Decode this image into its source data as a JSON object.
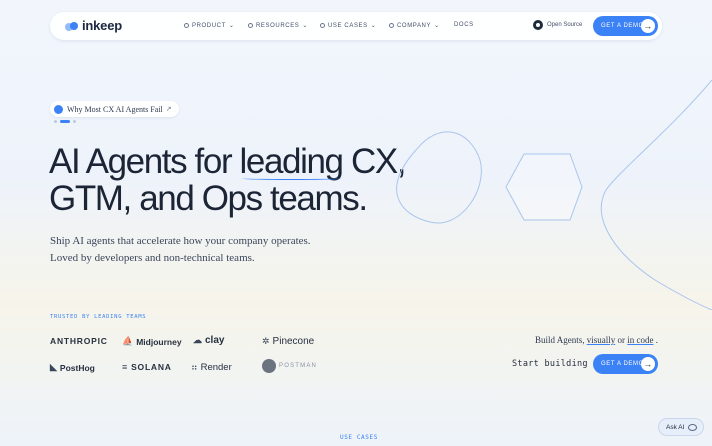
{
  "nav": {
    "logo": "inkeep",
    "items": [
      {
        "label": "PRODUCT",
        "has_menu": true
      },
      {
        "label": "RESOURCES",
        "has_menu": true
      },
      {
        "label": "USE CASES",
        "has_menu": true
      },
      {
        "label": "COMPANY",
        "has_menu": true
      },
      {
        "label": "DOCS",
        "has_menu": false
      }
    ],
    "github_label": "Open Source",
    "cta": "GET A DEMO"
  },
  "announcement": {
    "text": "Why Most CX AI Agents Fail",
    "icon": "external-link-icon"
  },
  "hero": {
    "title_line1_before": "AI Agents for ",
    "title_highlight": "leading",
    "title_line1_after": " CX,",
    "title_line2": "GTM, and Ops teams.",
    "subtitle_line1": "Ship AI agents that accelerate how your company operates.",
    "subtitle_line2": "Loved by developers and non-technical teams."
  },
  "trusted": {
    "label": "TRUSTED BY LEADING TEAMS",
    "logos": [
      "ANTHROPIC",
      "Midjourney",
      "clay",
      "Pinecone",
      "PostHog",
      "SOLANA",
      "Render",
      "POSTMAN"
    ]
  },
  "build": {
    "prefix": "Build Agents, ",
    "link_visual": "visually",
    "or": " or ",
    "link_code": "in code",
    "suffix": " .",
    "start_label": "Start building",
    "cta": "GET A DEMO"
  },
  "ask_ai": "Ask AI",
  "footer_section": "USE CASES",
  "colors": {
    "accent": "#3b82f6",
    "text": "#1c2536"
  }
}
